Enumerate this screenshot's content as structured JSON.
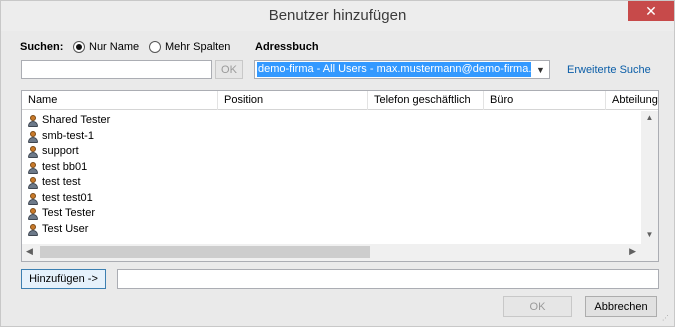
{
  "window": {
    "title": "Benutzer hinzufügen",
    "close_glyph": "✕"
  },
  "search": {
    "label": "Suchen:",
    "radio_name_only": "Nur Name",
    "radio_more_columns": "Mehr Spalten",
    "selected": "Nur Name",
    "input_value": "",
    "ok_label": "OK"
  },
  "addressbook": {
    "label": "Adressbuch",
    "selected": "demo-firma - All Users - max.mustermann@demo-firma.de",
    "advanced_search_link": "Erweiterte Suche"
  },
  "list": {
    "columns": [
      "Name",
      "Position",
      "Telefon geschäftlich",
      "Büro",
      "Abteilung"
    ],
    "rows": [
      "Shared Tester",
      "smb-test-1",
      "support",
      "test bb01",
      "test test",
      "test test01",
      "Test Tester",
      "Test User"
    ]
  },
  "add": {
    "button_label": "Hinzufügen ->",
    "field_value": ""
  },
  "footer": {
    "ok_label": "OK",
    "cancel_label": "Abbrechen"
  },
  "icons": {
    "user": "user-icon",
    "close": "close-icon",
    "dropdown": "chevron-down-icon",
    "scroll_up": "arrow-up-icon",
    "scroll_down": "arrow-down-icon",
    "scroll_left": "arrow-left-icon",
    "scroll_right": "arrow-right-icon"
  },
  "colors": {
    "selection": "#3399ff",
    "link": "#0b5ea8",
    "close_button": "#c74a4a"
  }
}
